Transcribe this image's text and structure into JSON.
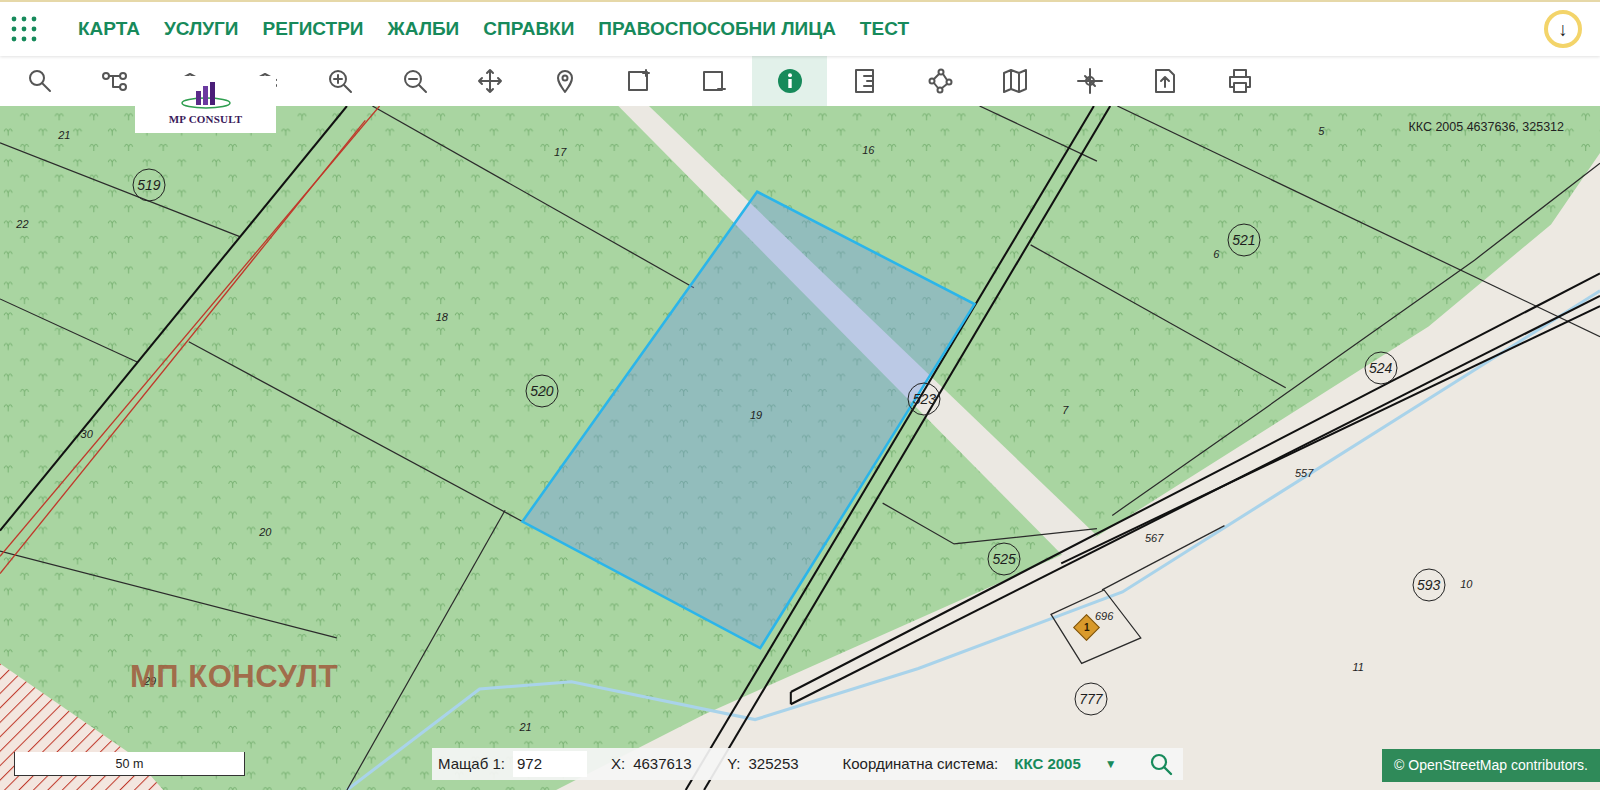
{
  "nav": {
    "items": [
      {
        "label": "КАРТА"
      },
      {
        "label": "УСЛУГИ"
      },
      {
        "label": "РЕГИСТРИ"
      },
      {
        "label": "ЖАЛБИ"
      },
      {
        "label": "СПРАВКИ"
      },
      {
        "label": "ПРАВОСПОСОБНИ ЛИЦА"
      },
      {
        "label": "ТЕСТ"
      }
    ]
  },
  "download": {
    "label": "↓"
  },
  "toolbar": {
    "tools": [
      {
        "selected": false
      },
      {
        "selected": false
      },
      {
        "selected": false
      },
      {
        "selected": false
      },
      {
        "selected": false
      },
      {
        "selected": false
      },
      {
        "selected": false
      },
      {
        "selected": false
      },
      {
        "selected": false
      },
      {
        "selected": false
      },
      {
        "selected": true
      },
      {
        "selected": false
      },
      {
        "selected": false
      },
      {
        "selected": false
      },
      {
        "selected": false
      },
      {
        "selected": false
      },
      {
        "selected": false
      }
    ]
  },
  "logo": {
    "text": "MP CONSULT"
  },
  "map": {
    "coordinates": "ККС 2005 4637636, 325312",
    "parcels": [
      {
        "label": "21",
        "selected": false
      },
      {
        "label": "17",
        "selected": false
      },
      {
        "label": "16",
        "selected": false
      },
      {
        "label": "5",
        "selected": false
      },
      {
        "label": "22",
        "selected": false
      },
      {
        "label": "18",
        "selected": false
      },
      {
        "label": "6",
        "selected": false
      },
      {
        "label": "30",
        "selected": false
      },
      {
        "label": "20",
        "selected": false
      },
      {
        "label": "19",
        "selected": true
      },
      {
        "label": "7",
        "selected": false
      },
      {
        "label": "557",
        "selected": false
      },
      {
        "label": "567",
        "selected": false
      },
      {
        "label": "10",
        "selected": false
      },
      {
        "label": "696",
        "selected": false
      },
      {
        "label": "11",
        "selected": false
      },
      {
        "label": "29",
        "selected": false
      },
      {
        "label": "21",
        "selected": false
      }
    ],
    "blocks": [
      {
        "label": "519"
      },
      {
        "label": "521"
      },
      {
        "label": "520"
      },
      {
        "label": "523"
      },
      {
        "label": "524"
      },
      {
        "label": "525"
      },
      {
        "label": "593"
      },
      {
        "label": "777"
      }
    ],
    "markers": [
      {
        "label": "1"
      }
    ],
    "watermark": "МП КОНСУЛТ"
  },
  "scale": {
    "label": "50 m"
  },
  "status": {
    "scale_label": "Мащаб 1:",
    "scale_value": "972",
    "x_label": "X:",
    "x_value": "4637613",
    "y_label": "Y:",
    "y_value": "325253",
    "crs_label": "Координатна система:",
    "crs_value": "ККС 2005",
    "crs_caret": "▼"
  },
  "attribution": "© OpenStreetMap contributors."
}
